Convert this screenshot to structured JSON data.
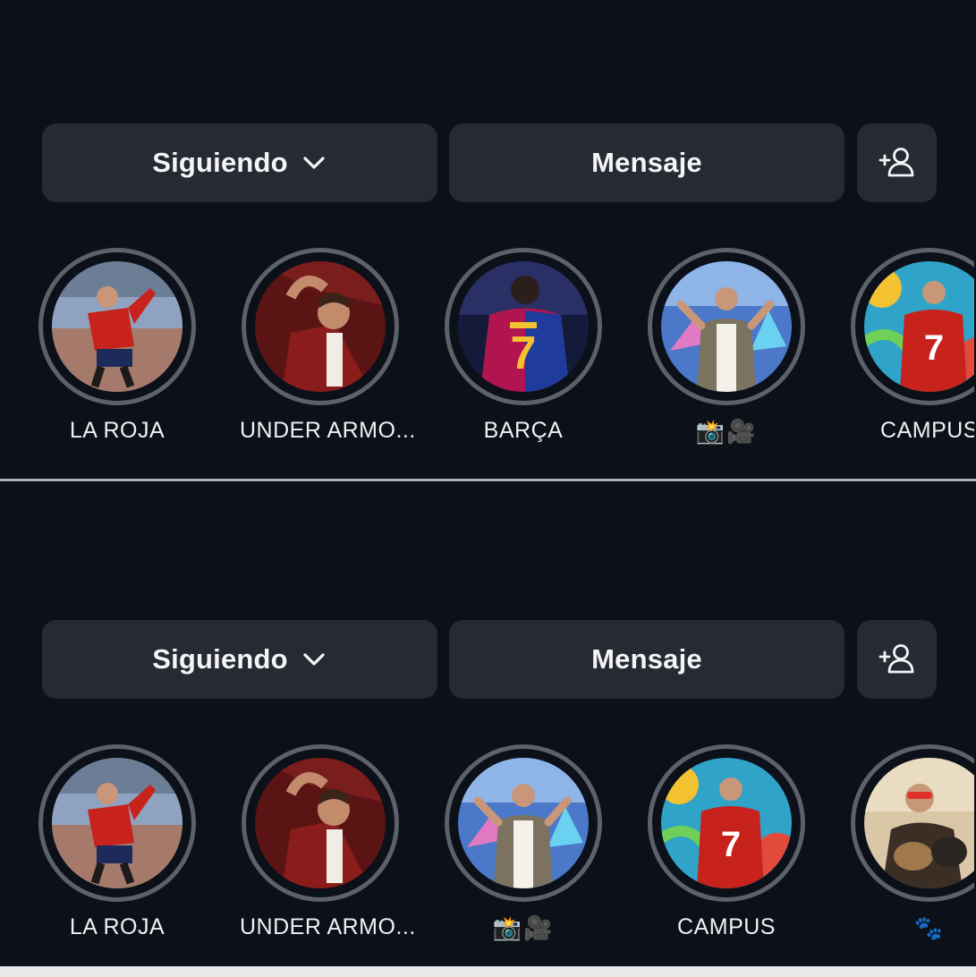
{
  "panels": [
    {
      "buttons": {
        "following_label": "Siguiendo",
        "message_label": "Mensaje"
      },
      "stories": [
        {
          "label": "LA ROJA"
        },
        {
          "label": "UNDER ARMO..."
        },
        {
          "label": "BARÇA"
        },
        {
          "label": "📸🎥"
        },
        {
          "label": "CAMPUS"
        }
      ]
    },
    {
      "buttons": {
        "following_label": "Siguiendo",
        "message_label": "Mensaje"
      },
      "stories": [
        {
          "label": "LA ROJA"
        },
        {
          "label": "UNDER ARMO..."
        },
        {
          "label": "📸🎥"
        },
        {
          "label": "CAMPUS"
        },
        {
          "label": "🐾"
        }
      ]
    }
  ],
  "theme": {
    "background": "#0c1019",
    "button": "#262a33",
    "ring": "#5d616a",
    "text": "#f2f2f4"
  }
}
